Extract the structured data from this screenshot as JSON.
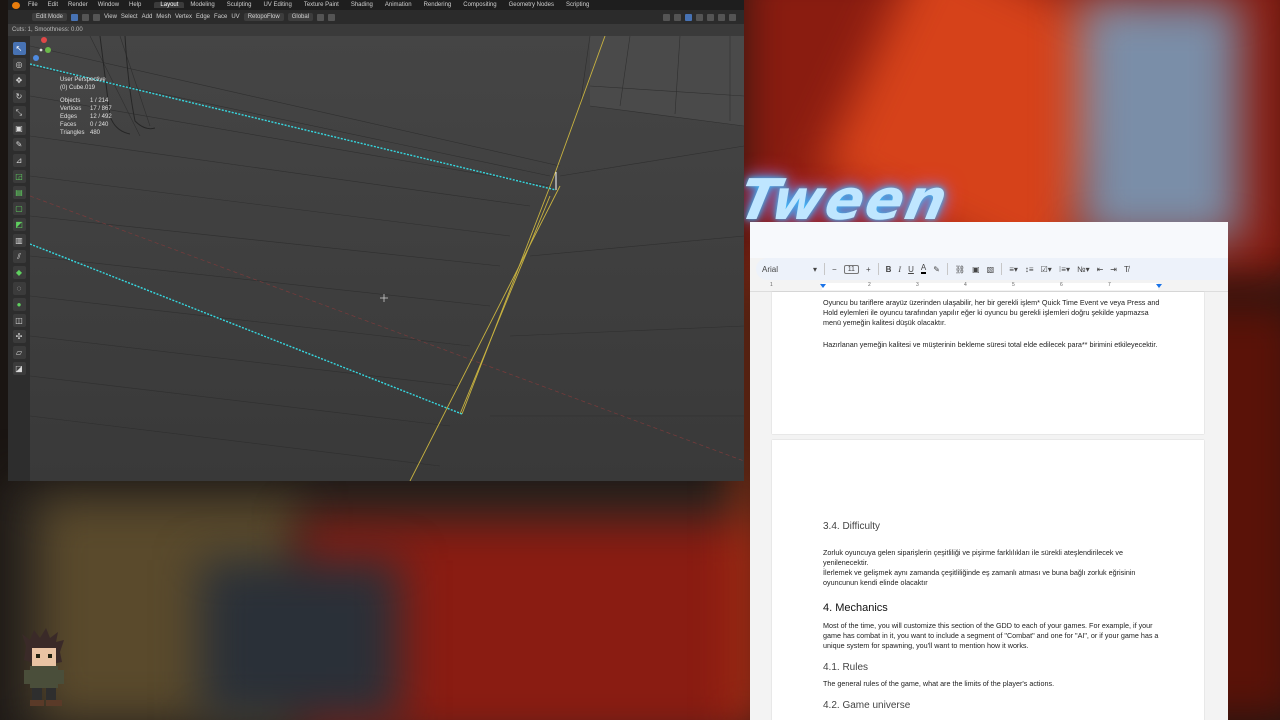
{
  "blender": {
    "menu": [
      "File",
      "Edit",
      "Render",
      "Window",
      "Help"
    ],
    "workspace_tabs": [
      "Layout",
      "Modeling",
      "Sculpting",
      "UV Editing",
      "Texture Paint",
      "Shading",
      "Animation",
      "Rendering",
      "Compositing",
      "Geometry Nodes",
      "Scripting"
    ],
    "active_tab": "Layout",
    "header": {
      "mode": "Edit Mode",
      "menus": [
        "View",
        "Select",
        "Add",
        "Mesh",
        "Vertex",
        "Edge",
        "Face",
        "UV"
      ],
      "snap": "RetopoFlow",
      "transform": "Global"
    },
    "status_line": "Cuts: 1, Smoothness: 0.00",
    "overlay": {
      "view": "User Perspective",
      "object": "(0) Cube.019",
      "stats": [
        {
          "k": "Objects",
          "v": "1 / 214"
        },
        {
          "k": "Vertices",
          "v": "17 / 867"
        },
        {
          "k": "Edges",
          "v": "12 / 492"
        },
        {
          "k": "Faces",
          "v": "0 / 240"
        },
        {
          "k": "Triangles",
          "v": "480"
        }
      ]
    },
    "tools": [
      "select-tool",
      "cursor-tool",
      "move-tool",
      "rotate-tool",
      "scale-tool",
      "transform-tool",
      "annotate-tool",
      "measure-tool",
      "add-cube-tool",
      "extrude-tool",
      "inset-tool",
      "bevel-tool",
      "loop-cut-tool",
      "knife-tool",
      "poly-build-tool",
      "spin-tool",
      "smooth-tool",
      "edge-slide-tool",
      "shrink-fatten-tool",
      "shear-tool",
      "rip-tool"
    ]
  },
  "background": {
    "neon_text": "Tween"
  },
  "docs": {
    "toolbar": {
      "font": "Arial",
      "size": "11"
    },
    "ruler": [
      "1",
      "2",
      "3",
      "4",
      "5",
      "6",
      "7"
    ],
    "page1": {
      "para1": "Oyuncu bu tariflere arayüz üzerinden ulaşabilir, her bir gerekli işlem* Quick Time Event ve veya Press and Hold eylemleri ile oyuncu tarafından yapılır eğer ki oyuncu bu gerekli işlemleri doğru şekilde yapmazsa  menü yemeğin kalitesi düşük olacaktır.",
      "para2": "Hazırlanan yemeğin kalitesi ve müşterinin bekleme süresi total elde edilecek para** birimini etkileyecektir."
    },
    "page2": {
      "difficulty_heading": "3.4. Difficulty",
      "difficulty_p1": "Zorluk oyuncuya gelen siparişlerin çeşitliliği ve pişirme farklılıkları ile sürekli ateşlendirilecek ve yenilenecektir.",
      "difficulty_p2": "İlerlemek ve gelişmek aynı zamanda çeşitliliğinde eş zamanlı atması ve buna bağlı zorluk eğrisinin oyuncunun kendi elinde olacaktır",
      "mechanics_heading": "4. Mechanics",
      "mechanics_p": "Most of the time, you will customize this section of the GDD to each of your games. For example, if your game has combat in it, you want to include a segment of \"Combat\" and one for \"AI\", or if your game has a unique system for spawning, you'll want to mention how it works.",
      "rules_heading": "4.1. Rules",
      "rules_p": "The general rules of the game, what are the limits of the player's actions.",
      "universe_heading": "4.2. Game universe"
    }
  }
}
